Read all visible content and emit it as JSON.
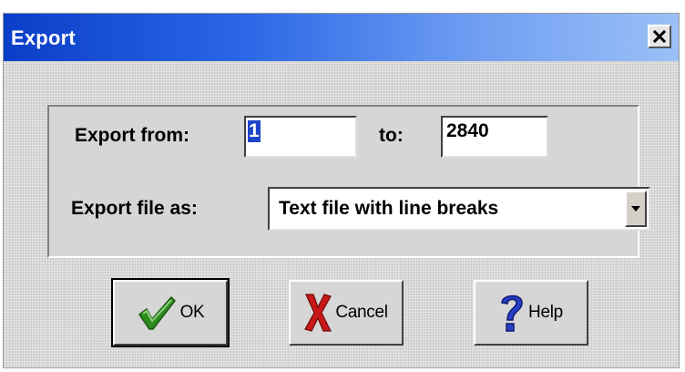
{
  "dialog": {
    "title": "Export",
    "close_symbol": "×"
  },
  "export_range": {
    "from_label": "Export from:",
    "from_value": "1",
    "to_label": "to:",
    "to_value": "2840"
  },
  "file_format": {
    "label": "Export file as:",
    "selected": "Text file with line breaks"
  },
  "buttons": {
    "ok_label": "OK",
    "cancel_label": "Cancel",
    "help_label": "Help"
  },
  "icons": {
    "ok": "checkmark-icon",
    "cancel": "red-x-icon",
    "help": "question-mark-icon",
    "dropdown": "chevron-down-icon"
  },
  "colors": {
    "title_bar_start": "#0a3ec8",
    "title_bar_end": "#9cc0f7",
    "selection": "#1f44c7",
    "ok_icon": "#2e8b1f",
    "cancel_icon": "#c81818",
    "help_icon": "#2a3fc8"
  }
}
